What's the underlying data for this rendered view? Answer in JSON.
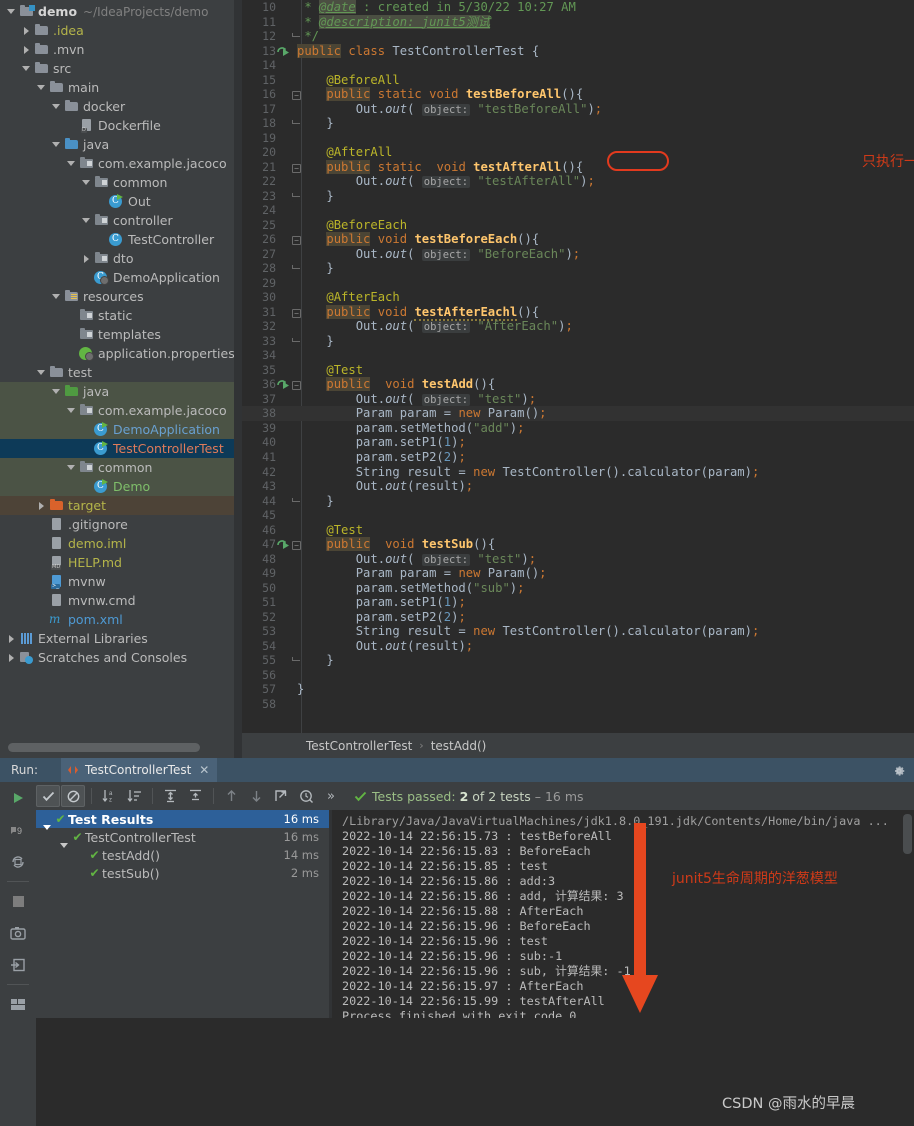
{
  "project_tree": [
    {
      "indent": 0,
      "arrow": "open",
      "icon": "folder-module",
      "label": "demo",
      "sub": "~/IdeaProjects/demo",
      "style": "c-white"
    },
    {
      "indent": 1,
      "arrow": "closed",
      "icon": "folder",
      "label": ".idea",
      "style": "c-olive"
    },
    {
      "indent": 1,
      "arrow": "closed",
      "icon": "folder",
      "label": ".mvn",
      "style": ""
    },
    {
      "indent": 1,
      "arrow": "open",
      "icon": "folder",
      "label": "src",
      "style": ""
    },
    {
      "indent": 2,
      "arrow": "open",
      "icon": "folder",
      "label": "main",
      "style": ""
    },
    {
      "indent": 3,
      "arrow": "open",
      "icon": "folder",
      "label": "docker",
      "style": ""
    },
    {
      "indent": 4,
      "arrow": "none",
      "icon": "file-docker",
      "label": "Dockerfile",
      "style": ""
    },
    {
      "indent": 3,
      "arrow": "open",
      "icon": "folder-blue",
      "label": "java",
      "style": ""
    },
    {
      "indent": 4,
      "arrow": "open",
      "icon": "package",
      "label": "com.example.jacoco",
      "style": ""
    },
    {
      "indent": 5,
      "arrow": "open",
      "icon": "package",
      "label": "common",
      "style": ""
    },
    {
      "indent": 6,
      "arrow": "none",
      "icon": "class-run",
      "label": "Out",
      "style": ""
    },
    {
      "indent": 5,
      "arrow": "open",
      "icon": "package",
      "label": "controller",
      "style": ""
    },
    {
      "indent": 6,
      "arrow": "none",
      "icon": "class",
      "label": "TestController",
      "style": ""
    },
    {
      "indent": 5,
      "arrow": "closed",
      "icon": "package",
      "label": "dto",
      "style": ""
    },
    {
      "indent": 5,
      "arrow": "none",
      "icon": "class-spring",
      "label": "DemoApplication",
      "style": ""
    },
    {
      "indent": 3,
      "arrow": "open",
      "icon": "folder-resources",
      "label": "resources",
      "style": ""
    },
    {
      "indent": 4,
      "arrow": "none",
      "icon": "package",
      "label": "static",
      "style": ""
    },
    {
      "indent": 4,
      "arrow": "none",
      "icon": "package",
      "label": "templates",
      "style": ""
    },
    {
      "indent": 4,
      "arrow": "none",
      "icon": "file-properties",
      "label": "application.properties",
      "style": ""
    },
    {
      "indent": 2,
      "arrow": "open",
      "icon": "folder",
      "label": "test",
      "style": ""
    },
    {
      "indent": 3,
      "arrow": "open",
      "icon": "folder-green",
      "label": "java",
      "style": "",
      "row": "hl-green"
    },
    {
      "indent": 4,
      "arrow": "open",
      "icon": "package",
      "label": "com.example.jacoco",
      "style": "",
      "row": "hl-green"
    },
    {
      "indent": 5,
      "arrow": "none",
      "icon": "class-test",
      "label": "DemoApplication",
      "style": "c-blue",
      "row": "hl-green"
    },
    {
      "indent": 5,
      "arrow": "none",
      "icon": "class-test",
      "label": "TestControllerTest",
      "style": "c-testred",
      "row": "hl-sel"
    },
    {
      "indent": 4,
      "arrow": "open",
      "icon": "package",
      "label": "common",
      "style": "",
      "row": "hl-green"
    },
    {
      "indent": 5,
      "arrow": "none",
      "icon": "class-run",
      "label": "Demo",
      "style": "c-green",
      "row": "hl-green"
    },
    {
      "indent": 2,
      "arrow": "closed",
      "icon": "folder-orange",
      "label": "target",
      "style": "c-olive",
      "row": "hl-target"
    },
    {
      "indent": 2,
      "arrow": "none",
      "icon": "file",
      "label": ".gitignore",
      "style": ""
    },
    {
      "indent": 2,
      "arrow": "none",
      "icon": "file-iml",
      "label": "demo.iml",
      "style": "c-olive"
    },
    {
      "indent": 2,
      "arrow": "none",
      "icon": "file-md",
      "label": "HELP.md",
      "style": "c-olive"
    },
    {
      "indent": 2,
      "arrow": "none",
      "icon": "file-terminal",
      "label": "mvnw",
      "style": ""
    },
    {
      "indent": 2,
      "arrow": "none",
      "icon": "file",
      "label": "mvnw.cmd",
      "style": ""
    },
    {
      "indent": 2,
      "arrow": "none",
      "icon": "file-xml",
      "label": "pom.xml",
      "style": "c-cyan"
    },
    {
      "indent": 0,
      "arrow": "closed",
      "icon": "libraries",
      "label": "External Libraries",
      "style": ""
    },
    {
      "indent": 0,
      "arrow": "closed",
      "icon": "scratches",
      "label": "Scratches and Consoles",
      "style": ""
    }
  ],
  "editor": {
    "first_line_number": 10,
    "lines": [
      {
        "n": 10,
        "partial": true
      },
      {
        "n": 11
      },
      {
        "n": 12,
        "fold": "end"
      },
      {
        "n": 13,
        "run": true
      },
      {
        "n": 14
      },
      {
        "n": 15
      },
      {
        "n": 16,
        "fold": "open"
      },
      {
        "n": 17
      },
      {
        "n": 18,
        "fold": "end"
      },
      {
        "n": 19
      },
      {
        "n": 20
      },
      {
        "n": 21,
        "fold": "open"
      },
      {
        "n": 22
      },
      {
        "n": 23,
        "fold": "end"
      },
      {
        "n": 24
      },
      {
        "n": 25
      },
      {
        "n": 26,
        "fold": "open"
      },
      {
        "n": 27
      },
      {
        "n": 28,
        "fold": "end"
      },
      {
        "n": 29
      },
      {
        "n": 30
      },
      {
        "n": 31,
        "fold": "open"
      },
      {
        "n": 32
      },
      {
        "n": 33,
        "fold": "end"
      },
      {
        "n": 34
      },
      {
        "n": 35
      },
      {
        "n": 36,
        "run": true,
        "fold": "open"
      },
      {
        "n": 37
      },
      {
        "n": 38,
        "current": true
      },
      {
        "n": 39
      },
      {
        "n": 40
      },
      {
        "n": 41
      },
      {
        "n": 42
      },
      {
        "n": 43
      },
      {
        "n": 44,
        "fold": "end"
      },
      {
        "n": 45
      },
      {
        "n": 46
      },
      {
        "n": 47,
        "run": true,
        "fold": "open"
      },
      {
        "n": 48
      },
      {
        "n": 49
      },
      {
        "n": 50
      },
      {
        "n": 51
      },
      {
        "n": 52
      },
      {
        "n": 53
      },
      {
        "n": 54
      },
      {
        "n": 55,
        "fold": "end"
      },
      {
        "n": 56
      },
      {
        "n": 57
      },
      {
        "n": 58
      }
    ],
    "code_text": {
      "l10": "* @date : created in 5/30/22 10:27 AM",
      "l11": "* @description: junit5测试",
      "l12": "*/",
      "l13": "public class TestControllerTest {",
      "l15": "@BeforeAll",
      "l16": "public static void testBeforeAll(){",
      "l17": "Out.out( object: \"testBeforeAll\");",
      "l18": "}",
      "l20": "@AfterAll",
      "l21": "public static  void testAfterAll(){",
      "l22": "Out.out( object: \"testAfterAll\");",
      "l23": "}",
      "l25": "@BeforeEach",
      "l26": "public void testBeforeEach(){",
      "l27": "Out.out( object: \"BeforeEach\");",
      "l28": "}",
      "l30": "@AfterEach",
      "l31": "public void testAfterEachl(){",
      "l32": "Out.out( object: \"AfterEach\");",
      "l33": "}",
      "l35": "@Test",
      "l36": "public  void testAdd(){",
      "l37": "Out.out( object: \"test\");",
      "l38": "Param param = new Param();",
      "l39": "param.setMethod(\"add\");",
      "l40": "param.setP1(1);",
      "l41": "param.setP2(2);",
      "l42": "String result = new TestController().calculator(param);",
      "l43": "Out.out(result);",
      "l44": "}",
      "l46": "@Test",
      "l47": "public  void testSub(){",
      "l48": "Out.out( object: \"test\");",
      "l49": "Param param = new Param();",
      "l50": "param.setMethod(\"sub\");",
      "l51": "param.setP1(1);",
      "l52": "param.setP2(2);",
      "l53": "String result = new TestController().calculator(param);",
      "l54": "Out.out(result);",
      "l55": "}",
      "l57": "}"
    }
  },
  "annotations": {
    "static_note": "只执行一次，必须是 static",
    "onion_note": "junit5生命周期的洋葱模型",
    "highlight_color": "#e23a1e",
    "note_color": "#cf3a18"
  },
  "breadcrumb": {
    "class": "TestControllerTest",
    "separator": "›",
    "method": "testAdd()"
  },
  "run_panel": {
    "run_label": "Run:",
    "tab_label": "TestControllerTest",
    "tab_close": "✕",
    "gear_icon": "gear-icon",
    "left_toolbar": [
      "rerun-icon",
      "rerun-failed-icon",
      "toggle-auto-test-icon",
      "stop-icon",
      "screenshot-icon",
      "export-icon",
      "layout-icon",
      "pin-icon"
    ],
    "toolbar_icons": [
      "show-passed-icon",
      "hide-ignored-icon",
      "sort-alphabetically-icon",
      "sort-by-duration-icon",
      "expand-all-icon",
      "collapse-all-icon",
      "prev-failed-icon",
      "next-failed-icon",
      "export-results-icon",
      "history-icon",
      "more-icon"
    ],
    "more_label": "»",
    "status": {
      "prefix": "Tests passed:",
      "count": "2",
      "of": "of 2 tests",
      "dash": "–",
      "duration": "16 ms"
    },
    "test_tree": [
      {
        "indent": 0,
        "arrow": true,
        "label": "Test Results",
        "ms": "16 ms",
        "selected": true
      },
      {
        "indent": 1,
        "arrow": true,
        "label": "TestControllerTest",
        "ms": "16 ms",
        "selected": false
      },
      {
        "indent": 2,
        "arrow": false,
        "label": "testAdd()",
        "ms": "14 ms",
        "selected": false
      },
      {
        "indent": 2,
        "arrow": false,
        "label": "testSub()",
        "ms": "2 ms",
        "selected": false
      }
    ],
    "console_lines": [
      {
        "text": "/Library/Java/JavaVirtualMachines/jdk1.8.0_191.jdk/Contents/Home/bin/java ...",
        "dim": true
      },
      {
        "text": "2022-10-14 22:56:15.73 : testBeforeAll"
      },
      {
        "text": "2022-10-14 22:56:15.83 : BeforeEach"
      },
      {
        "text": "2022-10-14 22:56:15.85 : test"
      },
      {
        "text": "2022-10-14 22:56:15.86 : add:3"
      },
      {
        "text": "2022-10-14 22:56:15.86 : add, 计算结果: 3"
      },
      {
        "text": "2022-10-14 22:56:15.88 : AfterEach"
      },
      {
        "text": "2022-10-14 22:56:15.96 : BeforeEach"
      },
      {
        "text": "2022-10-14 22:56:15.96 : test"
      },
      {
        "text": "2022-10-14 22:56:15.96 : sub:-1"
      },
      {
        "text": "2022-10-14 22:56:15.96 : sub, 计算结果: -1"
      },
      {
        "text": "2022-10-14 22:56:15.97 : AfterEach"
      },
      {
        "text": "2022-10-14 22:56:15.99 : testAfterAll"
      },
      {
        "text": "Process finished with exit code 0"
      }
    ]
  },
  "watermark": "CSDN @雨水的早晨"
}
